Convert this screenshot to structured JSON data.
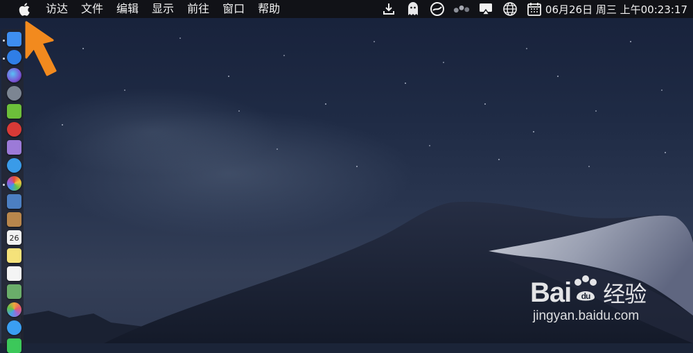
{
  "menubar": {
    "apple_icon": "apple-icon",
    "items": [
      "访达",
      "文件",
      "编辑",
      "显示",
      "前往",
      "窗口",
      "帮助"
    ],
    "status_icons": [
      "download-icon",
      "ghost-icon",
      "sync-icon",
      "dots-icon",
      "screen-mirror-icon",
      "globe-icon",
      "calendar-icon"
    ],
    "clock": "06月26日 周三 上午00:23:17"
  },
  "pointer": {
    "icon": "arrow-pointer-icon",
    "color": "#f28a1e"
  },
  "dock": {
    "items": [
      {
        "name": "finder-icon",
        "color": "#3e8ef0"
      },
      {
        "name": "app-store-icon",
        "color": "#2f7ee6"
      },
      {
        "name": "siri-icon",
        "color": "#7a55d6"
      },
      {
        "name": "launchpad-icon",
        "color": "#7c8592"
      },
      {
        "name": "android-icon",
        "color": "#6cbf3a"
      },
      {
        "name": "red-app-icon",
        "color": "#d93a36"
      },
      {
        "name": "purple-app-icon",
        "color": "#9c7ad8"
      },
      {
        "name": "safari-icon",
        "color": "#3a9be8"
      },
      {
        "name": "color-wheel-icon",
        "color": "#e8a030"
      },
      {
        "name": "preview-icon",
        "color": "#4c7fc2"
      },
      {
        "name": "notebook-icon",
        "color": "#b8864c"
      },
      {
        "name": "calendar-app-icon",
        "color": "#f2f2f2"
      },
      {
        "name": "notes-icon",
        "color": "#f5e27a"
      },
      {
        "name": "reminders-icon",
        "color": "#f4f4f4"
      },
      {
        "name": "maps-icon",
        "color": "#6aad6a"
      },
      {
        "name": "photos-icon",
        "color": "#f0a43c"
      },
      {
        "name": "messages-icon",
        "color": "#3a9ef2"
      },
      {
        "name": "facetime-icon",
        "color": "#3cc85a"
      }
    ],
    "calendar_day": "26"
  },
  "watermark": {
    "brand": "Bai",
    "brand_suffix": "经验",
    "site": "jingyan.baidu.com"
  }
}
